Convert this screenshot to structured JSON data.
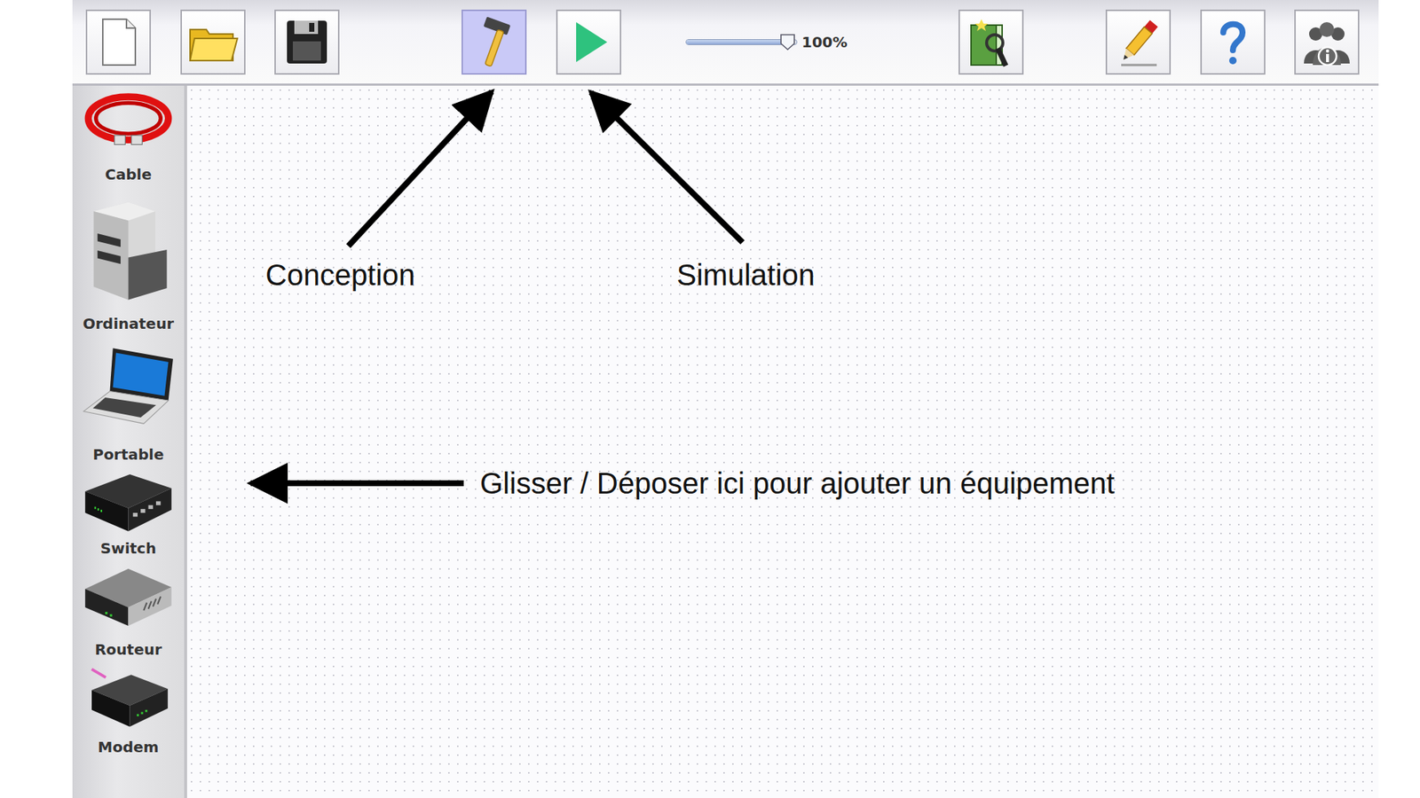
{
  "toolbar": {
    "items": [
      {
        "kind": "new",
        "selected": false
      },
      {
        "kind": "open",
        "selected": false
      },
      {
        "kind": "save",
        "selected": false
      },
      {
        "kind": "design",
        "selected": true
      },
      {
        "kind": "simulate",
        "selected": false
      },
      {
        "kind": "zoom",
        "level": 0.92,
        "reading": "100%"
      },
      {
        "kind": "wizard",
        "selected": false
      },
      {
        "kind": "edit",
        "selected": false
      },
      {
        "kind": "help",
        "selected": false
      },
      {
        "kind": "info",
        "selected": false
      }
    ]
  },
  "sidebar": {
    "items": [
      {
        "label": "Cable",
        "kind": "cable"
      },
      {
        "label": "Ordinateur",
        "kind": "computer"
      },
      {
        "label": "Portable",
        "kind": "laptop"
      },
      {
        "label": "Switch",
        "kind": "switch"
      },
      {
        "label": "Routeur",
        "kind": "router"
      },
      {
        "label": "Modem",
        "kind": "modem"
      }
    ]
  },
  "annotations": [
    {
      "text": "Conception"
    },
    {
      "text": "Simulation"
    },
    {
      "text": "Glisser / Déposer ici pour ajouter un équipement"
    }
  ]
}
